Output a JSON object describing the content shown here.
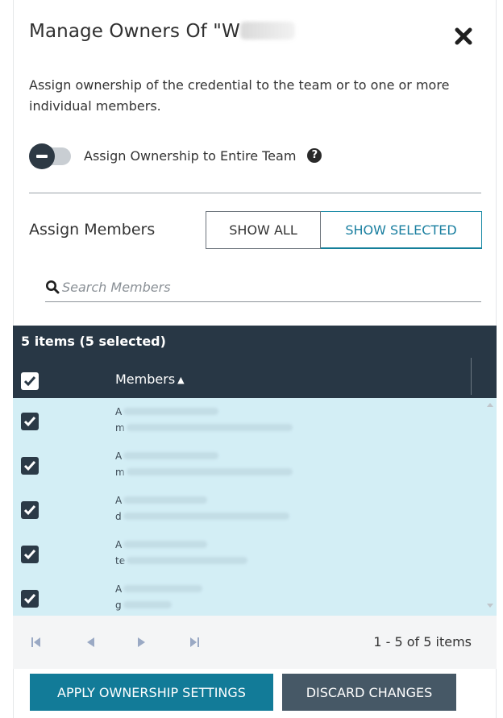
{
  "dialog": {
    "title": "Manage Owners Of \"W",
    "close_icon": "close-icon",
    "description": "Assign ownership of the credential to the team or to one or more individual members."
  },
  "team_toggle": {
    "label": "Assign Ownership to Entire Team",
    "enabled": false,
    "help_icon": "question-circle-icon",
    "help_glyph": "?"
  },
  "assign": {
    "label": "Assign Members",
    "show_all": "SHOW ALL",
    "show_selected": "SHOW SELECTED",
    "active_filter": "show_selected"
  },
  "search": {
    "placeholder": "Search Members",
    "value": "",
    "icon": "search-icon"
  },
  "grid": {
    "items_count": "5 items (5 selected)",
    "column_header": "Members",
    "sort_indicator": "▲",
    "sort_direction": "ascending",
    "select_all_checked": true,
    "rows": [
      {
        "name": "A",
        "email": "m",
        "checked": true
      },
      {
        "name": "A",
        "email": "m",
        "checked": true
      },
      {
        "name": "A",
        "email": "d",
        "checked": true
      },
      {
        "name": "A",
        "email": "te",
        "checked": true
      },
      {
        "name": "A",
        "email": "g",
        "checked": true
      }
    ]
  },
  "pager": {
    "first_icon": "first-page-icon",
    "prev_icon": "prev-page-icon",
    "next_icon": "next-page-icon",
    "last_icon": "last-page-icon",
    "info": "1 - 5 of 5 items"
  },
  "actions": {
    "apply": "APPLY OWNERSHIP SETTINGS",
    "discard": "DISCARD CHANGES"
  },
  "colors": {
    "header_bg": "#283745",
    "row_selected_bg": "#d3eef5",
    "primary": "#127b98",
    "secondary": "#465866",
    "accent_text": "#1a7fa0"
  }
}
